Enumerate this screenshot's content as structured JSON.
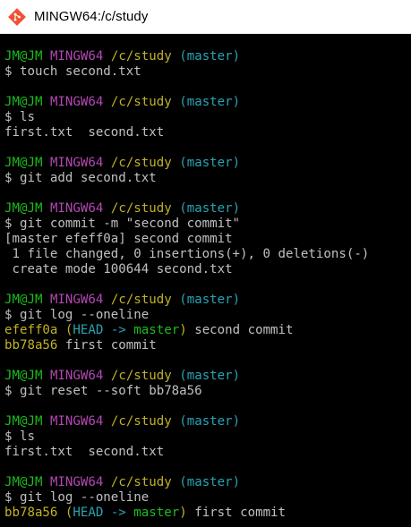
{
  "window": {
    "title": "MINGW64:/c/study",
    "icon": "git-bash-icon"
  },
  "colors": {
    "background": "#000000",
    "text": "#c0c0c0",
    "user": "#1cbc1c",
    "shell": "#b448b4",
    "path": "#c2b225",
    "branch": "#2aa3b3",
    "hash": "#c2b225"
  },
  "prompt": {
    "user": "JM@JM",
    "shell": "MINGW64",
    "path": "/c/study",
    "branch": "(master)"
  },
  "blocks": [
    {
      "command": "$ touch second.txt",
      "output": []
    },
    {
      "command": "$ ls",
      "output": [
        "first.txt  second.txt"
      ]
    },
    {
      "command": "$ git add second.txt",
      "output": []
    },
    {
      "command": "$ git commit -m \"second commit\"",
      "output": [
        "[master efeff0a] second commit",
        " 1 file changed, 0 insertions(+), 0 deletions(-)",
        " create mode 100644 second.txt"
      ]
    },
    {
      "command": "$ git log --oneline",
      "log": [
        {
          "hash": "efeff0a",
          "refs_open": " (",
          "head": "HEAD ->",
          "sep": " ",
          "branch": "master",
          "refs_close": ")",
          "message": " second commit"
        },
        {
          "hash": "bb78a56",
          "message": " first commit"
        }
      ]
    },
    {
      "command": "$ git reset --soft bb78a56",
      "output": []
    },
    {
      "command": "$ ls",
      "output": [
        "first.txt  second.txt"
      ]
    },
    {
      "command": "$ git log --oneline",
      "log": [
        {
          "hash": "bb78a56",
          "refs_open": " (",
          "head": "HEAD ->",
          "sep": " ",
          "branch": "master",
          "refs_close": ")",
          "message": " first commit"
        }
      ]
    }
  ]
}
